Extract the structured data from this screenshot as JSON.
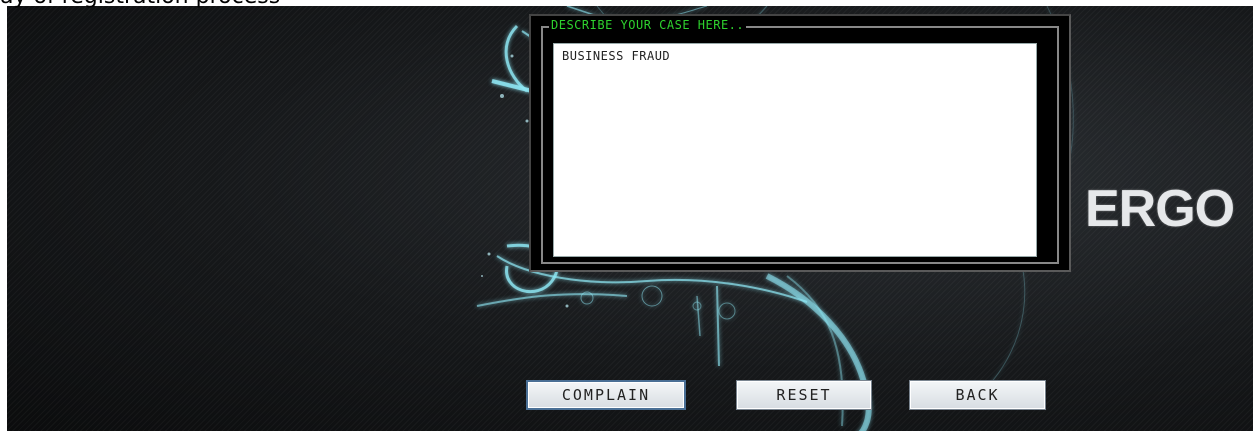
{
  "caption_fragment": "ay of registration process",
  "logo": {
    "text": "ERGO"
  },
  "case_box": {
    "legend": "DESCRIBE YOUR CASE HERE..",
    "value": "BUSINESS FRAUD"
  },
  "buttons": {
    "complain": "COMPLAIN",
    "reset": "RESET",
    "back": "BACK"
  },
  "colors": {
    "legend_green": "#2ed12e",
    "glow_cyan": "#7fe6f5"
  }
}
